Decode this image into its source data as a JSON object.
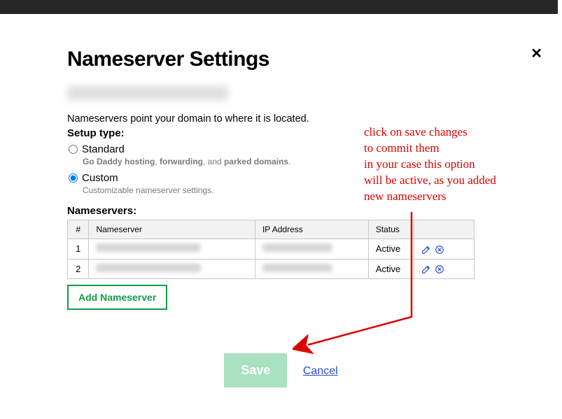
{
  "title": "Nameserver Settings",
  "intro": "Nameservers point your domain to where it is located.",
  "setup_label": "Setup type:",
  "options": {
    "standard": {
      "label": "Standard",
      "hint_pre": "Go Daddy hosting",
      "hint_mid": "forwarding",
      "hint_post": "parked domains"
    },
    "custom": {
      "label": "Custom",
      "hint": "Customizable nameserver settings."
    }
  },
  "ns_label": "Nameservers:",
  "table": {
    "headers": {
      "num": "#",
      "ns": "Nameserver",
      "ip": "IP Address",
      "status": "Status"
    },
    "rows": [
      {
        "num": "1",
        "status": "Active"
      },
      {
        "num": "2",
        "status": "Active"
      }
    ]
  },
  "add_btn": "Add Nameserver",
  "save_btn": "Save",
  "cancel": "Cancel",
  "annotation": {
    "l1": "click on save changes",
    "l2": "to commit them",
    "l3": "in your case this option",
    "l4": "will be active, as you added",
    "l5": "new nameservers"
  }
}
